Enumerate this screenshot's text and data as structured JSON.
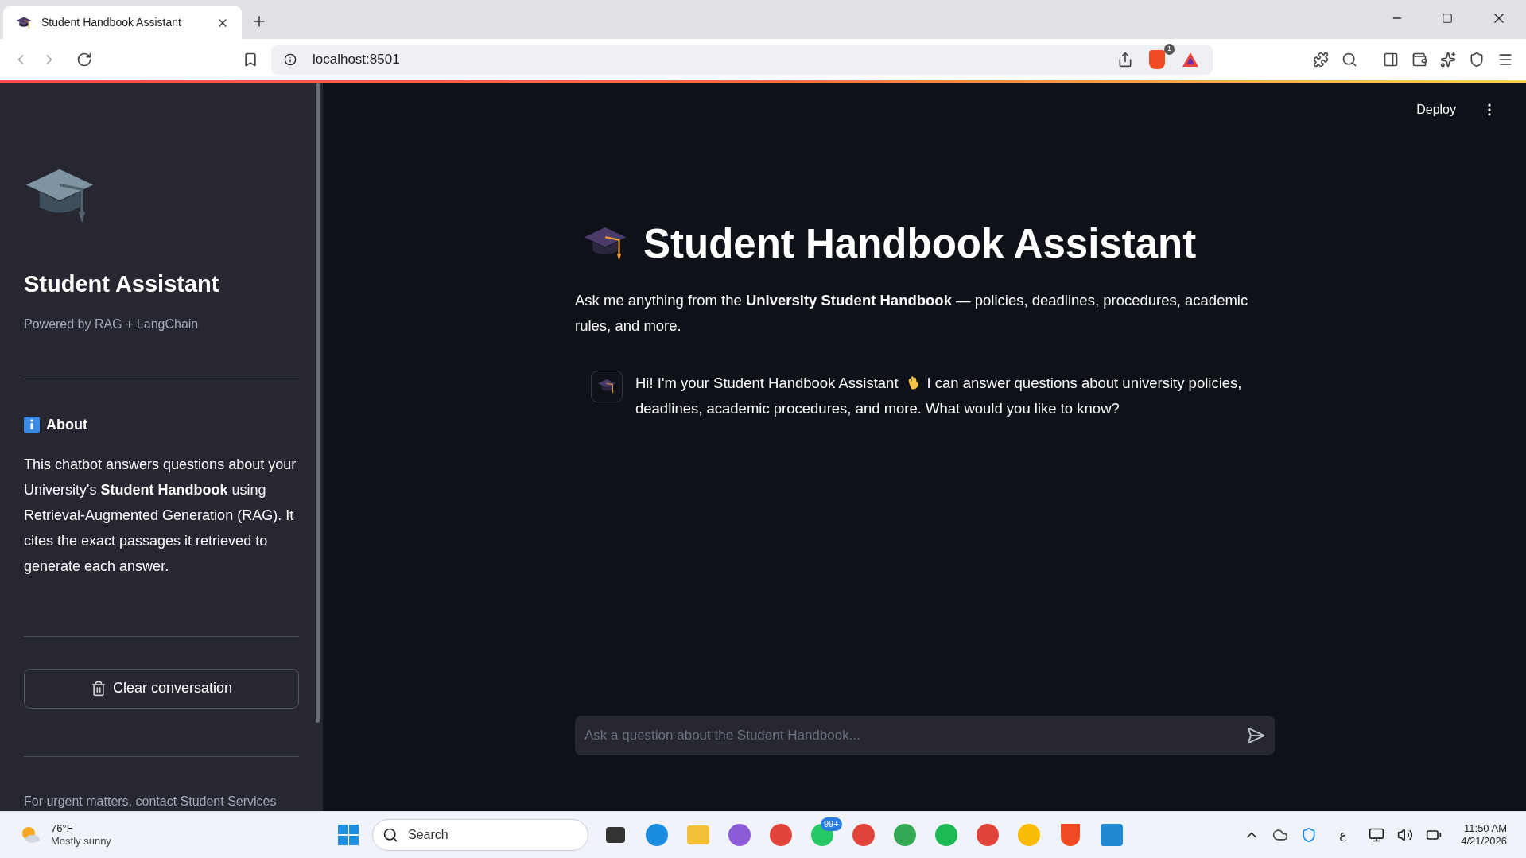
{
  "browser": {
    "tab": {
      "title": "Student Handbook Assistant",
      "selected": true
    },
    "address": "localhost:8501",
    "shields_badge": "1"
  },
  "sidebar": {
    "title": "Student Assistant",
    "subtitle": "Powered by RAG + LangChain",
    "about": {
      "heading": "About",
      "text": "This chatbot answers questions about your University's **Student Handbook** using Retrieval-Augmented Generation (RAG). It cites the exact passages it retrieved to generate each answer."
    },
    "clear_button": "Clear conversation",
    "footer": "For urgent matters, contact Student Services"
  },
  "header": {
    "deploy": "Deploy"
  },
  "main": {
    "title": "Student Handbook Assistant",
    "intro": "Ask me anything from the **University Student Handbook** — policies, deadlines, procedures, academic rules, and more.",
    "message": {
      "before": "Hi! I'm your Student Handbook Assistant",
      "after": "I can answer questions about university policies, deadlines, academic procedures, and more. What would you like to know?"
    }
  },
  "chat_input": {
    "placeholder": "Ask a question about the Student Handbook..."
  },
  "taskbar": {
    "weather": {
      "temp": "76°F",
      "desc": "Mostly sunny"
    },
    "search": "Search",
    "whatsapp_badge": "99+",
    "language": "ع",
    "time": "11:50 AM",
    "date": "4/21/2026"
  }
}
